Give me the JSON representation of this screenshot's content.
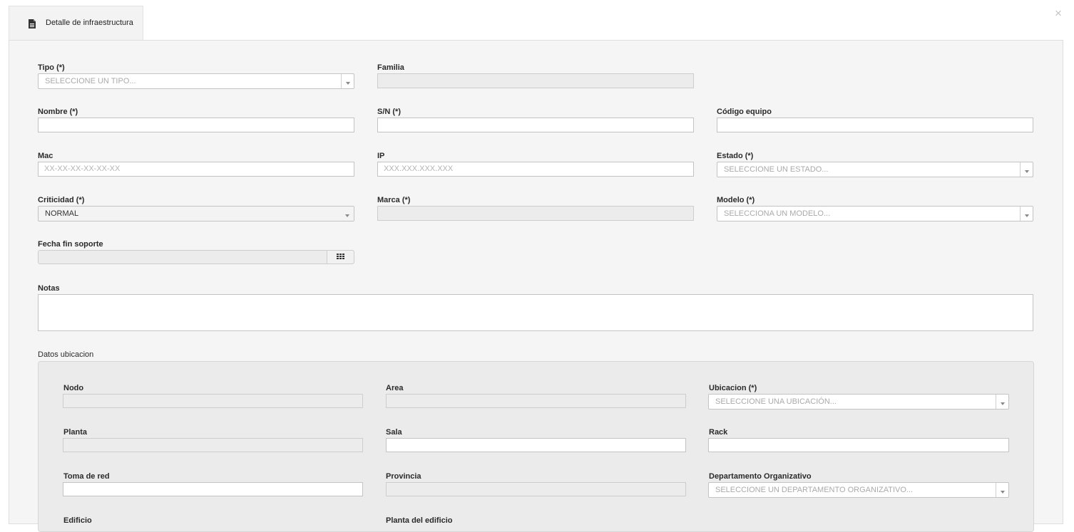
{
  "dialog": {
    "tab_label": "Detalle de infraestructura",
    "close_label": "×",
    "tab_icon": "document-icon"
  },
  "form": {
    "tipo": {
      "label": "Tipo (*)",
      "placeholder": "SELECCIONE UN TIPO..."
    },
    "familia": {
      "label": "Familia",
      "value": ""
    },
    "nombre": {
      "label": "Nombre (*)",
      "value": ""
    },
    "sn": {
      "label": "S/N (*)",
      "value": ""
    },
    "codigo_equipo": {
      "label": "Código equipo",
      "value": ""
    },
    "mac": {
      "label": "Mac",
      "placeholder": "XX-XX-XX-XX-XX-XX"
    },
    "ip": {
      "label": "IP",
      "placeholder": "XXX.XXX.XXX.XXX"
    },
    "estado": {
      "label": "Estado (*)",
      "placeholder": "SELECCIONE UN ESTADO..."
    },
    "criticidad": {
      "label": "Criticidad (*)",
      "value": "NORMAL"
    },
    "marca": {
      "label": "Marca (*)",
      "value": ""
    },
    "modelo": {
      "label": "Modelo (*)",
      "placeholder": "SELECCIONA UN MODELO..."
    },
    "fecha_fin_soporte": {
      "label": "Fecha fin soporte",
      "value": "",
      "icon": "calendar-grid-icon"
    },
    "notas": {
      "label": "Notas",
      "value": ""
    }
  },
  "ubicacion": {
    "section_title": "Datos ubicacion",
    "nodo": {
      "label": "Nodo"
    },
    "area": {
      "label": "Area"
    },
    "ubicacion": {
      "label": "Ubicacion (*)",
      "placeholder": "SELECCIONE UNA UBICACIÓN..."
    },
    "planta": {
      "label": "Planta"
    },
    "sala": {
      "label": "Sala"
    },
    "rack": {
      "label": "Rack"
    },
    "toma_red": {
      "label": "Toma de red"
    },
    "provincia": {
      "label": "Provincia"
    },
    "departamento": {
      "label": "Departamento Organizativo",
      "placeholder": "SELECCIONE UN DEPARTAMENTO ORGANIZATIVO..."
    },
    "edificio": {
      "label": "Edificio"
    },
    "planta_edificio": {
      "label": "Planta del edificio"
    }
  }
}
